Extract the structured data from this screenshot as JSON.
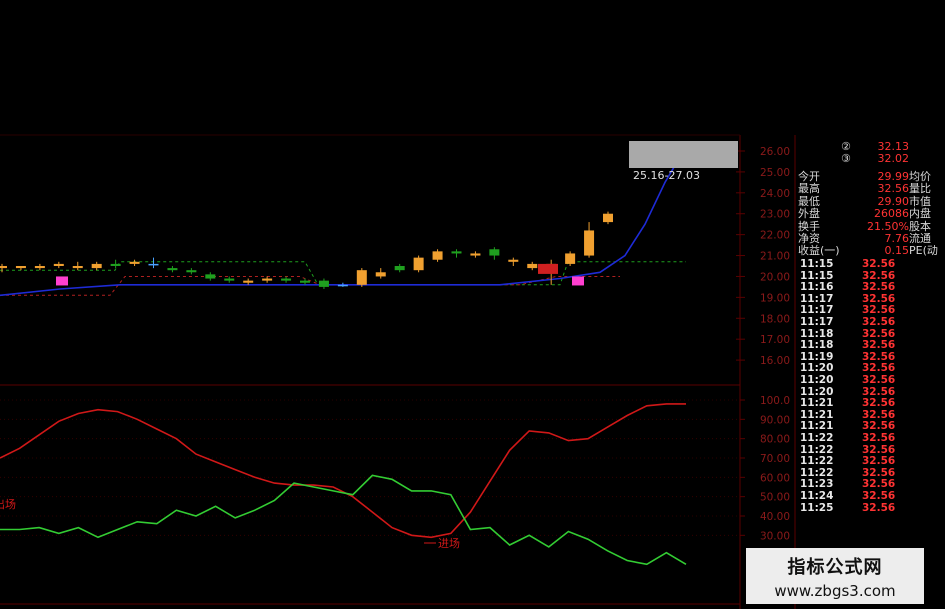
{
  "colors": {
    "background": "#000000",
    "grid": "#5a0000",
    "axis_text": "#8b1a1a",
    "up_candle": "#f0a030",
    "down_candle": "#1fa01f",
    "doji": "#4aa3ff",
    "ma_line": "#1e2bd6",
    "band_green": "#1e9e1e",
    "band_red": "#b02020",
    "indicator_red": "#d01818",
    "indicator_green": "#33cc33",
    "signal_magenta": "#ff3fd0"
  },
  "chart_data": [
    {
      "type": "candlestick",
      "ylim": [
        15,
        26
      ],
      "y_ticks": [
        "26.00",
        "25.00",
        "24.00",
        "23.00",
        "22.00",
        "21.00",
        "20.00",
        "19.00",
        "18.00",
        "17.00",
        "16.00"
      ],
      "range_label": "25.16-27.03",
      "candles": [
        {
          "o": 20.4,
          "c": 20.5,
          "h": 20.6,
          "l": 20.2
        },
        {
          "o": 20.4,
          "c": 20.5,
          "h": 20.5,
          "l": 20.3
        },
        {
          "o": 20.4,
          "c": 20.5,
          "h": 20.6,
          "l": 20.3
        },
        {
          "o": 20.5,
          "c": 20.6,
          "h": 20.7,
          "l": 20.4
        },
        {
          "o": 20.4,
          "c": 20.5,
          "h": 20.7,
          "l": 20.3
        },
        {
          "o": 20.4,
          "c": 20.6,
          "h": 20.7,
          "l": 20.3
        },
        {
          "o": 20.6,
          "c": 20.5,
          "h": 20.8,
          "l": 20.4
        },
        {
          "o": 20.6,
          "c": 20.7,
          "h": 20.8,
          "l": 20.5
        },
        {
          "o": 20.6,
          "c": 20.6,
          "h": 20.9,
          "l": 20.4
        },
        {
          "o": 20.4,
          "c": 20.3,
          "h": 20.5,
          "l": 20.2
        },
        {
          "o": 20.3,
          "c": 20.2,
          "h": 20.4,
          "l": 20.1
        },
        {
          "o": 20.1,
          "c": 19.9,
          "h": 20.2,
          "l": 19.8
        },
        {
          "o": 19.9,
          "c": 19.8,
          "h": 20.0,
          "l": 19.7
        },
        {
          "o": 19.7,
          "c": 19.8,
          "h": 19.9,
          "l": 19.6
        },
        {
          "o": 19.8,
          "c": 19.9,
          "h": 20.0,
          "l": 19.7
        },
        {
          "o": 19.9,
          "c": 19.8,
          "h": 20.0,
          "l": 19.7
        },
        {
          "o": 19.8,
          "c": 19.7,
          "h": 19.9,
          "l": 19.6
        },
        {
          "o": 19.8,
          "c": 19.5,
          "h": 19.9,
          "l": 19.4
        },
        {
          "o": 19.6,
          "c": 19.6,
          "h": 19.7,
          "l": 19.5
        },
        {
          "o": 19.6,
          "c": 20.3,
          "h": 20.4,
          "l": 19.5
        },
        {
          "o": 20.0,
          "c": 20.2,
          "h": 20.4,
          "l": 19.9
        },
        {
          "o": 20.5,
          "c": 20.3,
          "h": 20.6,
          "l": 20.2
        },
        {
          "o": 20.3,
          "c": 20.9,
          "h": 21.0,
          "l": 20.2
        },
        {
          "o": 20.8,
          "c": 21.2,
          "h": 21.3,
          "l": 20.7
        },
        {
          "o": 21.2,
          "c": 21.1,
          "h": 21.3,
          "l": 20.9
        },
        {
          "o": 21.0,
          "c": 21.1,
          "h": 21.2,
          "l": 20.9
        },
        {
          "o": 21.3,
          "c": 21.0,
          "h": 21.4,
          "l": 20.8
        },
        {
          "o": 20.7,
          "c": 20.8,
          "h": 20.9,
          "l": 20.5
        },
        {
          "o": 20.4,
          "c": 20.6,
          "h": 20.7,
          "l": 20.3
        },
        {
          "o": 20.2,
          "c": 20.6,
          "h": 20.8,
          "l": 19.6
        },
        {
          "o": 20.6,
          "c": 21.1,
          "h": 21.2,
          "l": 20.5
        },
        {
          "o": 21.0,
          "c": 22.2,
          "h": 22.6,
          "l": 20.9
        },
        {
          "o": 22.6,
          "c": 23.0,
          "h": 23.1,
          "l": 22.5
        }
      ],
      "buy_signal_label": "进场",
      "sell_signal_label": "出场"
    },
    {
      "type": "line",
      "ylim": [
        25,
        100
      ],
      "y_ticks": [
        "100.0",
        "90.00",
        "80.00",
        "70.00",
        "60.00",
        "50.00",
        "40.00",
        "30.00"
      ],
      "series": [
        {
          "color": "red",
          "values": [
            70,
            75,
            82,
            89,
            93,
            95,
            94,
            90,
            85,
            80,
            72,
            68,
            64,
            60,
            57,
            56,
            56,
            55,
            50,
            42,
            34,
            30,
            29,
            31,
            42,
            58,
            74,
            84,
            83,
            79,
            80,
            86,
            92,
            97,
            98,
            98
          ]
        },
        {
          "color": "green",
          "values": [
            33,
            33,
            34,
            31,
            34,
            29,
            33,
            37,
            36,
            43,
            40,
            45,
            39,
            43,
            48,
            57,
            55,
            53,
            51,
            61,
            59,
            53,
            53,
            51,
            33,
            34,
            25,
            30,
            24,
            32,
            28,
            22,
            17,
            15,
            21,
            15
          ]
        }
      ]
    }
  ],
  "quote_panel": {
    "top_rows": [
      {
        "label": "②",
        "value": "32.13"
      },
      {
        "label": "③",
        "value": "32.02"
      }
    ],
    "stats": [
      {
        "label": "今开",
        "value": "29.99",
        "label2": "均价"
      },
      {
        "label": "最高",
        "value": "32.56",
        "label2": "量比"
      },
      {
        "label": "最低",
        "value": "29.90",
        "label2": "市值"
      },
      {
        "label": "外盘",
        "value": "26086",
        "label2": "内盘"
      },
      {
        "label": "换手",
        "value": "21.50%",
        "label2": "股本"
      },
      {
        "label": "净资",
        "value": "7.76",
        "label2": "流通"
      },
      {
        "label": "收益(一)",
        "value": "0.15",
        "label2": "PE(动"
      }
    ],
    "ticks": [
      {
        "time": "11:15",
        "price": "32.56"
      },
      {
        "time": "11:15",
        "price": "32.56"
      },
      {
        "time": "11:16",
        "price": "32.56"
      },
      {
        "time": "11:17",
        "price": "32.56"
      },
      {
        "time": "11:17",
        "price": "32.56"
      },
      {
        "time": "11:17",
        "price": "32.56"
      },
      {
        "time": "11:18",
        "price": "32.56"
      },
      {
        "time": "11:18",
        "price": "32.56"
      },
      {
        "time": "11:19",
        "price": "32.56"
      },
      {
        "time": "11:20",
        "price": "32.56"
      },
      {
        "time": "11:20",
        "price": "32.56"
      },
      {
        "time": "11:20",
        "price": "32.56"
      },
      {
        "time": "11:21",
        "price": "32.56"
      },
      {
        "time": "11:21",
        "price": "32.56"
      },
      {
        "time": "11:21",
        "price": "32.56"
      },
      {
        "time": "11:22",
        "price": "32.56"
      },
      {
        "time": "11:22",
        "price": "32.56"
      },
      {
        "time": "11:22",
        "price": "32.56"
      },
      {
        "time": "11:22",
        "price": "32.56"
      },
      {
        "time": "11:23",
        "price": "32.56"
      },
      {
        "time": "11:24",
        "price": "32.56"
      },
      {
        "time": "11:25",
        "price": "32.56"
      }
    ]
  },
  "watermark": {
    "title": "指标公式网",
    "url": "www.zbgs3.com"
  }
}
